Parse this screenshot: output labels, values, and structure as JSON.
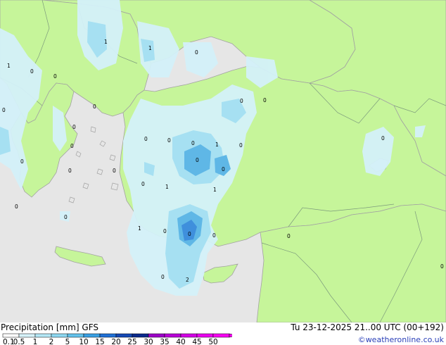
{
  "colors": {
    "sea": "#e6e6e6",
    "land": "#c6f59a",
    "coast": "#a2a2a2",
    "border": "#7c9a7c",
    "precip_light": "#d4f1f9",
    "precip_mid": "#a6e0f2",
    "precip_heavy": "#5fb7e6",
    "precip_core": "#3f8fdc",
    "credit": "#2a3fb8"
  },
  "header": {
    "title": "Precipitation [mm]",
    "model": "GFS",
    "datetime": "Tu 23-12-2025 21..00 UTC (00+192)",
    "credit": "©weatheronline.co.uk"
  },
  "legend": {
    "ticks": [
      "0.1",
      "0.5",
      "1",
      "2",
      "5",
      "10",
      "15",
      "20",
      "25",
      "30",
      "35",
      "40",
      "45",
      "50"
    ],
    "colors": [
      "#ffffff",
      "#d7f3fb",
      "#b4e7f6",
      "#8ed8f1",
      "#63c2ec",
      "#3aa0e3",
      "#2070d6",
      "#1549b4",
      "#0a2a8c",
      "#9d00c8",
      "#b900d8",
      "#d400e6",
      "#ea00ef",
      "#f800f2"
    ]
  },
  "map_values": [
    {
      "label": "1"
    },
    {
      "label": "1"
    },
    {
      "label": "0"
    },
    {
      "label": "1"
    },
    {
      "label": "0"
    },
    {
      "label": "0"
    },
    {
      "label": "0"
    },
    {
      "label": "0"
    },
    {
      "label": "0"
    },
    {
      "label": "0"
    },
    {
      "label": "0"
    },
    {
      "label": "0"
    },
    {
      "label": "0"
    },
    {
      "label": "0"
    },
    {
      "label": "0"
    },
    {
      "label": "1"
    },
    {
      "label": "0"
    },
    {
      "label": "0"
    },
    {
      "label": "0"
    },
    {
      "label": "0"
    },
    {
      "label": "0"
    },
    {
      "label": "1"
    },
    {
      "label": "1"
    },
    {
      "label": "0"
    },
    {
      "label": "0"
    },
    {
      "label": "0"
    },
    {
      "label": "1"
    },
    {
      "label": "0"
    },
    {
      "label": "0"
    },
    {
      "label": "0"
    },
    {
      "label": "0"
    },
    {
      "label": "2"
    },
    {
      "label": "0"
    },
    {
      "label": "0"
    },
    {
      "label": "0"
    },
    {
      "label": "0"
    }
  ]
}
